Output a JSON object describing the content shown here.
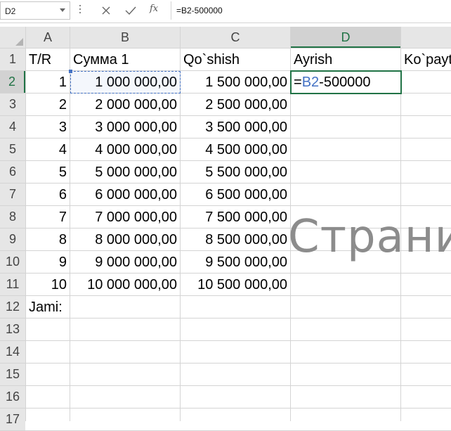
{
  "formula_bar": {
    "name_box": "D2",
    "fx_label": "fx",
    "formula": "=B2-500000"
  },
  "columns": [
    "A",
    "B",
    "C",
    "D"
  ],
  "selected_column": "D",
  "rows": [
    "1",
    "2",
    "3",
    "4",
    "5",
    "6",
    "7",
    "8",
    "9",
    "10",
    "11",
    "12",
    "13",
    "14",
    "15",
    "16",
    "17"
  ],
  "selected_row": "2",
  "headers": {
    "a1": "T/R",
    "b1": "Сумма 1",
    "c1": "Qo`shish",
    "d1": "Ayrish",
    "e1": "Ko`payt"
  },
  "table_rows": [
    {
      "tr": "1",
      "summa": "1 000 000,00",
      "qoshish": "1 500 000,00"
    },
    {
      "tr": "2",
      "summa": "2 000 000,00",
      "qoshish": "2 500 000,00"
    },
    {
      "tr": "3",
      "summa": "3 000 000,00",
      "qoshish": "3 500 000,00"
    },
    {
      "tr": "4",
      "summa": "4 000 000,00",
      "qoshish": "4 500 000,00"
    },
    {
      "tr": "5",
      "summa": "5 000 000,00",
      "qoshish": "5 500 000,00"
    },
    {
      "tr": "6",
      "summa": "6 000 000,00",
      "qoshish": "6 500 000,00"
    },
    {
      "tr": "7",
      "summa": "7 000 000,00",
      "qoshish": "7 500 000,00"
    },
    {
      "tr": "8",
      "summa": "8 000 000,00",
      "qoshish": "8 500 000,00"
    },
    {
      "tr": "9",
      "summa": "9 000 000,00",
      "qoshish": "9 500 000,00"
    },
    {
      "tr": "10",
      "summa": "10 000 000,00",
      "qoshish": "10 500 000,00"
    }
  ],
  "active_cell_edit": {
    "prefix": "=",
    "ref": "B2",
    "suffix": "-500000"
  },
  "jami_label": "Jami:",
  "page_watermark": "Страни",
  "colors": {
    "selection": "#217346",
    "reference": "#4472c4",
    "header_bg": "#e6e6e6"
  }
}
